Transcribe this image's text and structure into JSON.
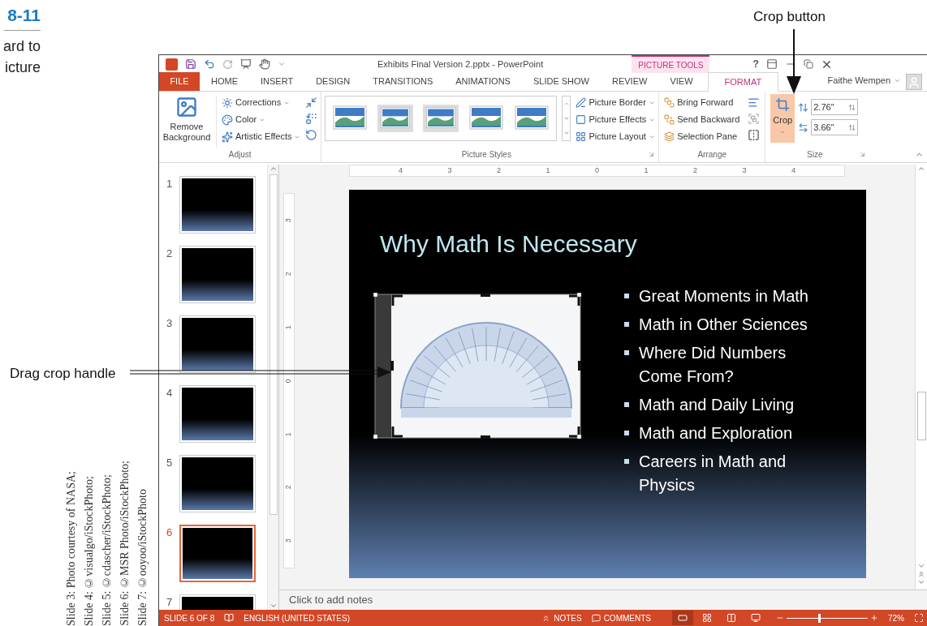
{
  "figure": {
    "number": "8-11",
    "caption_fragments": [
      "ard to",
      "icture"
    ],
    "callouts": [
      {
        "kind": "down",
        "text": "Crop button"
      },
      {
        "kind": "right",
        "text": "Drag crop handle"
      }
    ],
    "credits": [
      "Slide 3: Photo courtesy of NASA;",
      "Slide 4: ©visualgo/iStockPhoto;",
      "Slide 5: ©cdascher/iStockPhoto;",
      "Slide 6: ©MSR Photo/iStockPhoto;",
      "Slide 7: ©ooyoo/iStockPhoto"
    ]
  },
  "window": {
    "title": "Exhibits Final Version 2.pptx - PowerPoint",
    "contextual_tab": "PICTURE TOOLS",
    "help": "?",
    "user": "Faithe Wempen"
  },
  "tabs": [
    {
      "label": "FILE",
      "kind": "file",
      "selected": false
    },
    {
      "label": "HOME",
      "kind": "tab",
      "selected": false
    },
    {
      "label": "INSERT",
      "kind": "tab",
      "selected": false
    },
    {
      "label": "DESIGN",
      "kind": "tab",
      "selected": false
    },
    {
      "label": "TRANSITIONS",
      "kind": "tab",
      "selected": false
    },
    {
      "label": "ANIMATIONS",
      "kind": "tab",
      "selected": false
    },
    {
      "label": "SLIDE SHOW",
      "kind": "tab",
      "selected": false
    },
    {
      "label": "REVIEW",
      "kind": "tab",
      "selected": false
    },
    {
      "label": "VIEW",
      "kind": "tab",
      "selected": false
    },
    {
      "label": "FORMAT",
      "kind": "contextual",
      "selected": true
    }
  ],
  "ribbon": {
    "adjust": {
      "label": "Adjust",
      "remove_background": "Remove Background",
      "commands": [
        "Corrections",
        "Color",
        "Artistic Effects"
      ]
    },
    "picture_styles": {
      "label": "Picture Styles",
      "commands": [
        "Picture Border",
        "Picture Effects",
        "Picture Layout"
      ]
    },
    "arrange": {
      "label": "Arrange",
      "commands": [
        "Bring Forward",
        "Send Backward",
        "Selection Pane"
      ]
    },
    "size": {
      "label": "Size",
      "crop": "Crop",
      "crop_active": true,
      "height": "2.76\"",
      "width": "3.66\""
    }
  },
  "slides_pane": {
    "slides": [
      {
        "number": "1",
        "selected": false
      },
      {
        "number": "2",
        "selected": false
      },
      {
        "number": "3",
        "selected": false
      },
      {
        "number": "4",
        "selected": false
      },
      {
        "number": "5",
        "selected": false
      },
      {
        "number": "6",
        "selected": true
      },
      {
        "number": "7",
        "selected": false
      }
    ]
  },
  "rulers": {
    "horizontal": [
      "4",
      "3",
      "2",
      "1",
      "0",
      "1",
      "2",
      "3",
      "4"
    ],
    "vertical": [
      "3",
      "2",
      "1",
      "0",
      "1",
      "2",
      "3"
    ]
  },
  "slide": {
    "title": "Why Math Is Necessary",
    "bullets": [
      "Great Moments in Math",
      "Math in Other Sciences",
      "Where Did Numbers Come From?",
      "Math and Daily Living",
      "Math and Exploration",
      "Careers in Math and Physics"
    ]
  },
  "notes": {
    "placeholder": "Click to add notes"
  },
  "status_bar": {
    "slide": "SLIDE 6 OF 8",
    "language": "ENGLISH (UNITED STATES)",
    "notes": "NOTES",
    "comments": "COMMENTS",
    "views": [
      {
        "selected": true
      },
      {
        "selected": false
      },
      {
        "selected": false
      },
      {
        "selected": false
      }
    ],
    "zoom_level": {
      "level": 0.4
    },
    "zoom": "72%"
  }
}
